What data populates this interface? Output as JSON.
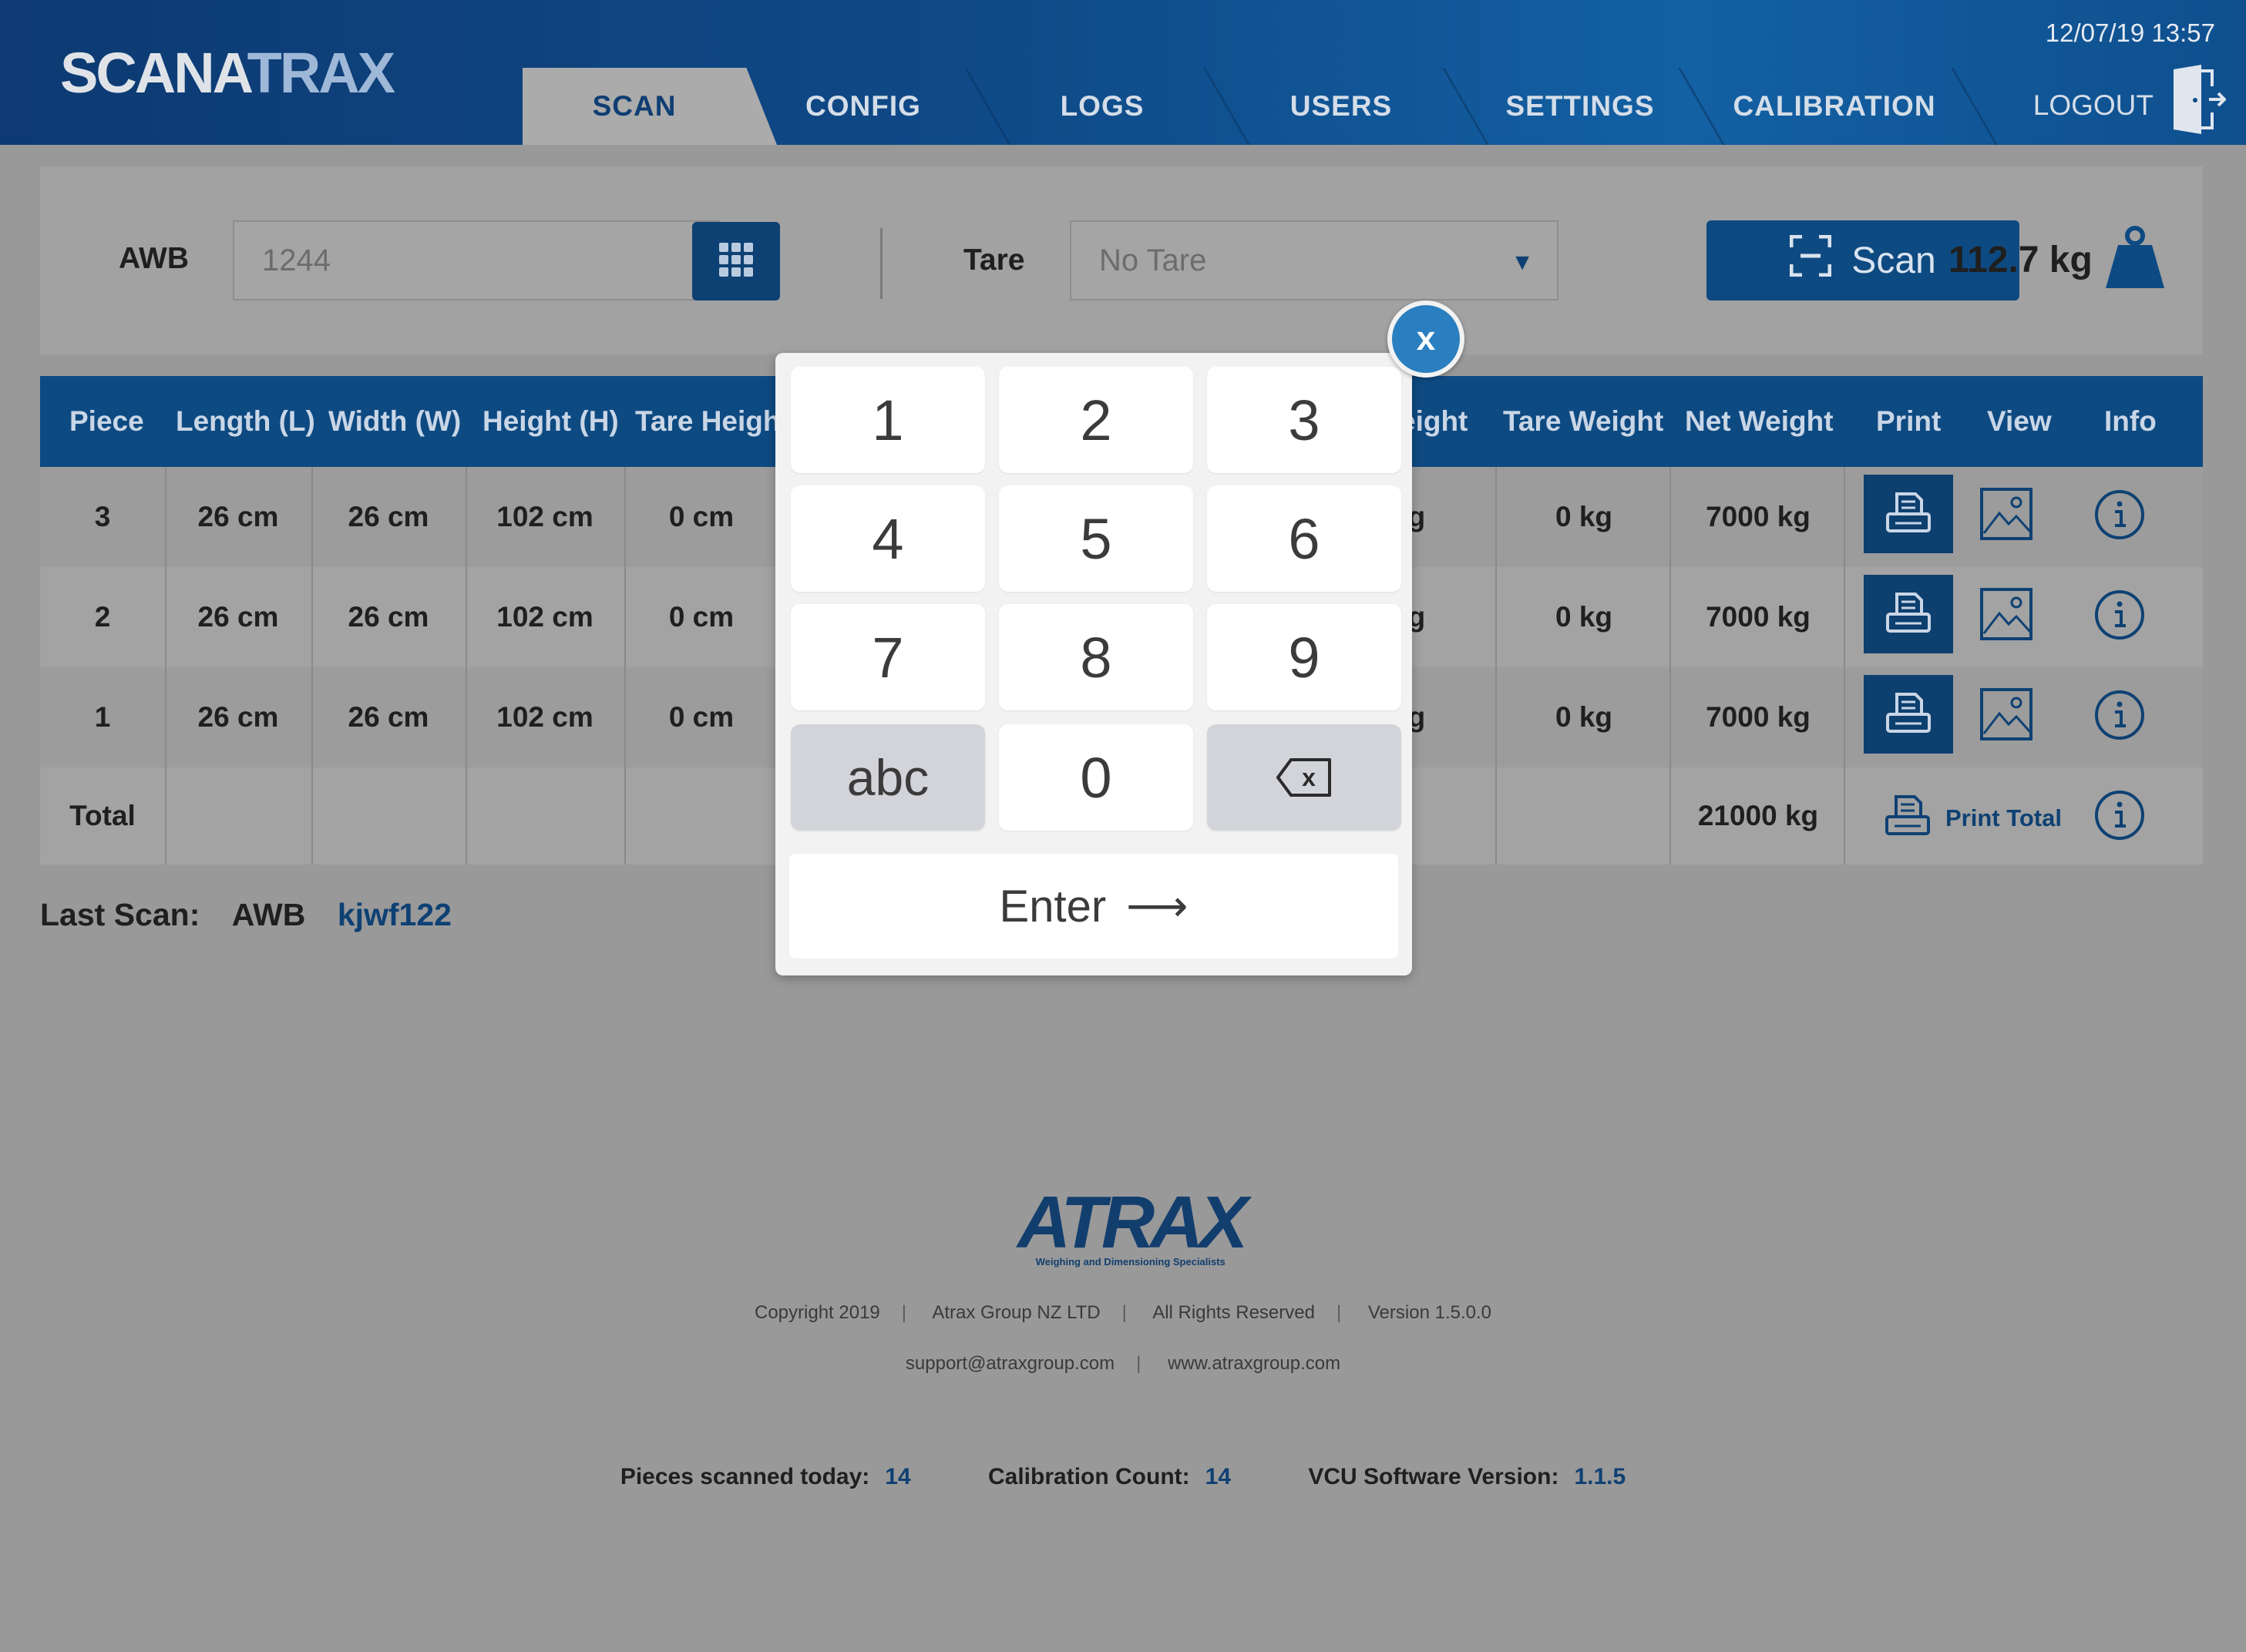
{
  "app": {
    "logo_a": "SCANA",
    "logo_b": "TRAX",
    "datetime": "12/07/19 13:57"
  },
  "nav": {
    "tabs": [
      {
        "label": "SCAN",
        "active": true
      },
      {
        "label": "CONFIG",
        "active": false
      },
      {
        "label": "LOGS",
        "active": false
      },
      {
        "label": "USERS",
        "active": false
      },
      {
        "label": "SETTINGS",
        "active": false
      },
      {
        "label": "CALIBRATION",
        "active": false
      }
    ],
    "logout_label": "LOGOUT",
    "logout_icon": "logout-door-icon"
  },
  "scan_bar": {
    "awb_label": "AWB",
    "awb_value": "1244",
    "keyboard_icon": "keypad-grid-icon",
    "tare_label": "Tare",
    "tare_selected": "No Tare",
    "scan_button_label": "Scan",
    "scan_icon": "scan-frame-icon",
    "weight_value": "112.7 kg",
    "weight_icon": "weight-icon"
  },
  "table": {
    "columns": [
      "Piece",
      "Length (L)",
      "Width (W)",
      "Height (H)",
      "Tare Heigh",
      "eight",
      "Tare Weight",
      "Net Weight",
      "Print",
      "View",
      "Info"
    ],
    "rows": [
      {
        "piece": "3",
        "length": "26 cm",
        "width": "26 cm",
        "height": "102 cm",
        "tare_height": "0 cm",
        "weight_partial": "kg",
        "tare_weight": "0 kg",
        "net_weight": "7000 kg"
      },
      {
        "piece": "2",
        "length": "26 cm",
        "width": "26 cm",
        "height": "102 cm",
        "tare_height": "0 cm",
        "weight_partial": "kg",
        "tare_weight": "0 kg",
        "net_weight": "7000 kg"
      },
      {
        "piece": "1",
        "length": "26 cm",
        "width": "26 cm",
        "height": "102 cm",
        "tare_height": "0 cm",
        "weight_partial": "kg",
        "tare_weight": "0 kg",
        "net_weight": "7000 kg"
      }
    ],
    "total": {
      "label": "Total",
      "net_weight": "21000 kg",
      "print_label": "Print Total"
    }
  },
  "last_scan": {
    "label": "Last Scan:",
    "awb_label": "AWB",
    "value": "kjwf122"
  },
  "footer": {
    "brand": "ATRAX",
    "tagline": "Weighing and Dimensioning Specialists",
    "line1": [
      "Copyright 2019",
      "Atrax Group NZ LTD",
      "All Rights Reserved",
      "Version 1.5.0.0"
    ],
    "line2": [
      "support@atraxgroup.com",
      "www.atraxgroup.com"
    ],
    "stats": {
      "pieces_label": "Pieces scanned today:",
      "pieces_value": "14",
      "calibration_label": "Calibration Count:",
      "calibration_value": "14",
      "vcu_label": "VCU Software Version:",
      "vcu_value": "1.1.5"
    }
  },
  "keypad": {
    "close_label": "x",
    "keys": [
      "1",
      "2",
      "3",
      "4",
      "5",
      "6",
      "7",
      "8",
      "9"
    ],
    "abc": "abc",
    "zero": "0",
    "backspace_icon": "backspace-icon",
    "backspace_glyph": "x",
    "enter_label": "Enter",
    "enter_arrow": "⟶"
  },
  "colors": {
    "brand_blue": "#0e4a82",
    "accent_blue": "#2a7fc0",
    "background": "#999999"
  }
}
